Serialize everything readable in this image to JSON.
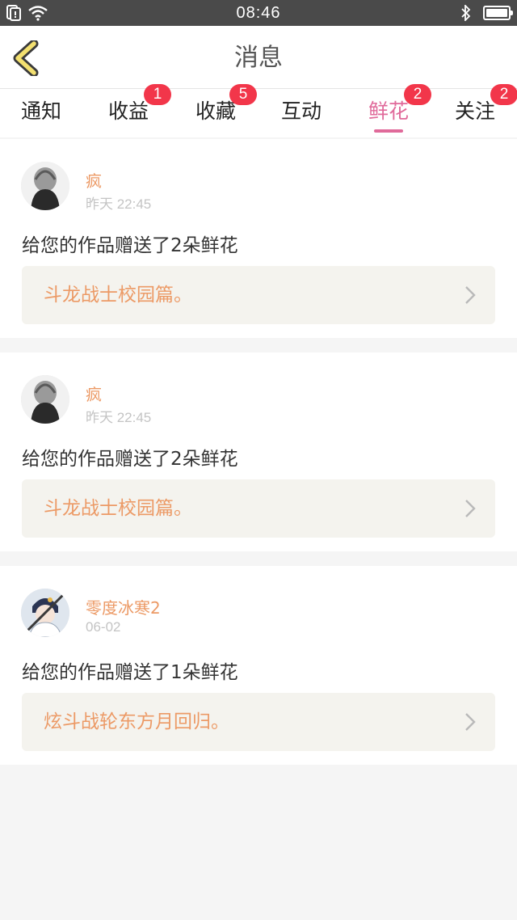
{
  "status_bar": {
    "time": "08:46"
  },
  "header": {
    "title": "消息"
  },
  "colors": {
    "accent_pink": "#e06a9a",
    "badge_red": "#f2364a",
    "name_orange": "#ec9a66"
  },
  "tabs": [
    {
      "label": "通知",
      "badge": ""
    },
    {
      "label": "收益",
      "badge": "1"
    },
    {
      "label": "收藏",
      "badge": "5"
    },
    {
      "label": "互动",
      "badge": ""
    },
    {
      "label": "鲜花",
      "badge": "2",
      "active": true
    },
    {
      "label": "关注",
      "badge": "2"
    }
  ],
  "messages": [
    {
      "user": "疯",
      "time": "昨天 22:45",
      "text": "给您的作品赠送了2朵鲜花",
      "work": "斗龙战士校园篇。"
    },
    {
      "user": "疯",
      "time": "昨天 22:45",
      "text": "给您的作品赠送了2朵鲜花",
      "work": "斗龙战士校园篇。"
    },
    {
      "user": "零度冰寒2",
      "time": "06-02",
      "text": "给您的作品赠送了1朵鲜花",
      "work": "炫斗战轮东方月回归。"
    }
  ]
}
